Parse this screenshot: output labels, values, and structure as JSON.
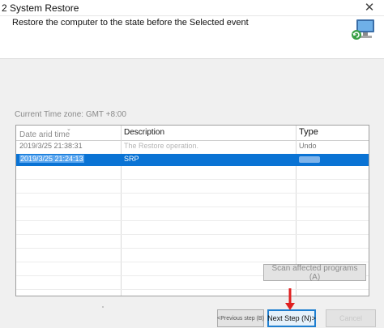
{
  "window": {
    "title": "2 System Restore",
    "close_glyph": "✕"
  },
  "header": {
    "instruction": "Restore the computer to the state before the Selected event",
    "icon": "computer-restore-icon"
  },
  "timezone": "Current Time zone: GMT +8:00",
  "list": {
    "columns": [
      "Date arid time",
      "Description",
      "Type"
    ],
    "rows": [
      {
        "date": "2019/3/25 21:38:31",
        "description": "The Restore operation.",
        "type": "Undo"
      },
      {
        "date": "2019/3/25 21:24:13",
        "description": "SRP",
        "type": ""
      }
    ]
  },
  "buttons": {
    "scan": "Scan affected programs (A)",
    "prev": "<Previous step (B)",
    "next": "Next Step (N)>",
    "cancel": "Cancel"
  },
  "colors": {
    "selection": "#0a73d4",
    "annotation_arrow": "#e02020",
    "next_border": "#1f7fd0"
  }
}
